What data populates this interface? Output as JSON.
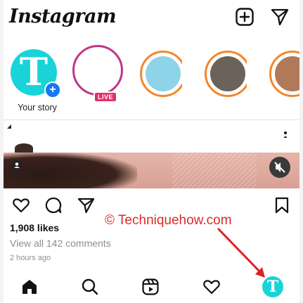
{
  "app": {
    "logo": "Instagram"
  },
  "header": {
    "icons": [
      "new-post-icon",
      "direct-message-icon"
    ]
  },
  "stories": {
    "your_story_label": "Your story",
    "your_story_avatar_letter": "T",
    "live_badge": "LIVE"
  },
  "post": {
    "likes": "1,908 likes",
    "comments": "View all 142 comments",
    "time": "2 hours ago"
  },
  "watermark": "© Techniquehow.com",
  "bottom_nav": {
    "profile_letter": "T"
  },
  "colors": {
    "accent": "#19d3d9",
    "link_blue": "#1877f2",
    "live_red": "#e1306c",
    "annotation_red": "#d92b2b"
  }
}
